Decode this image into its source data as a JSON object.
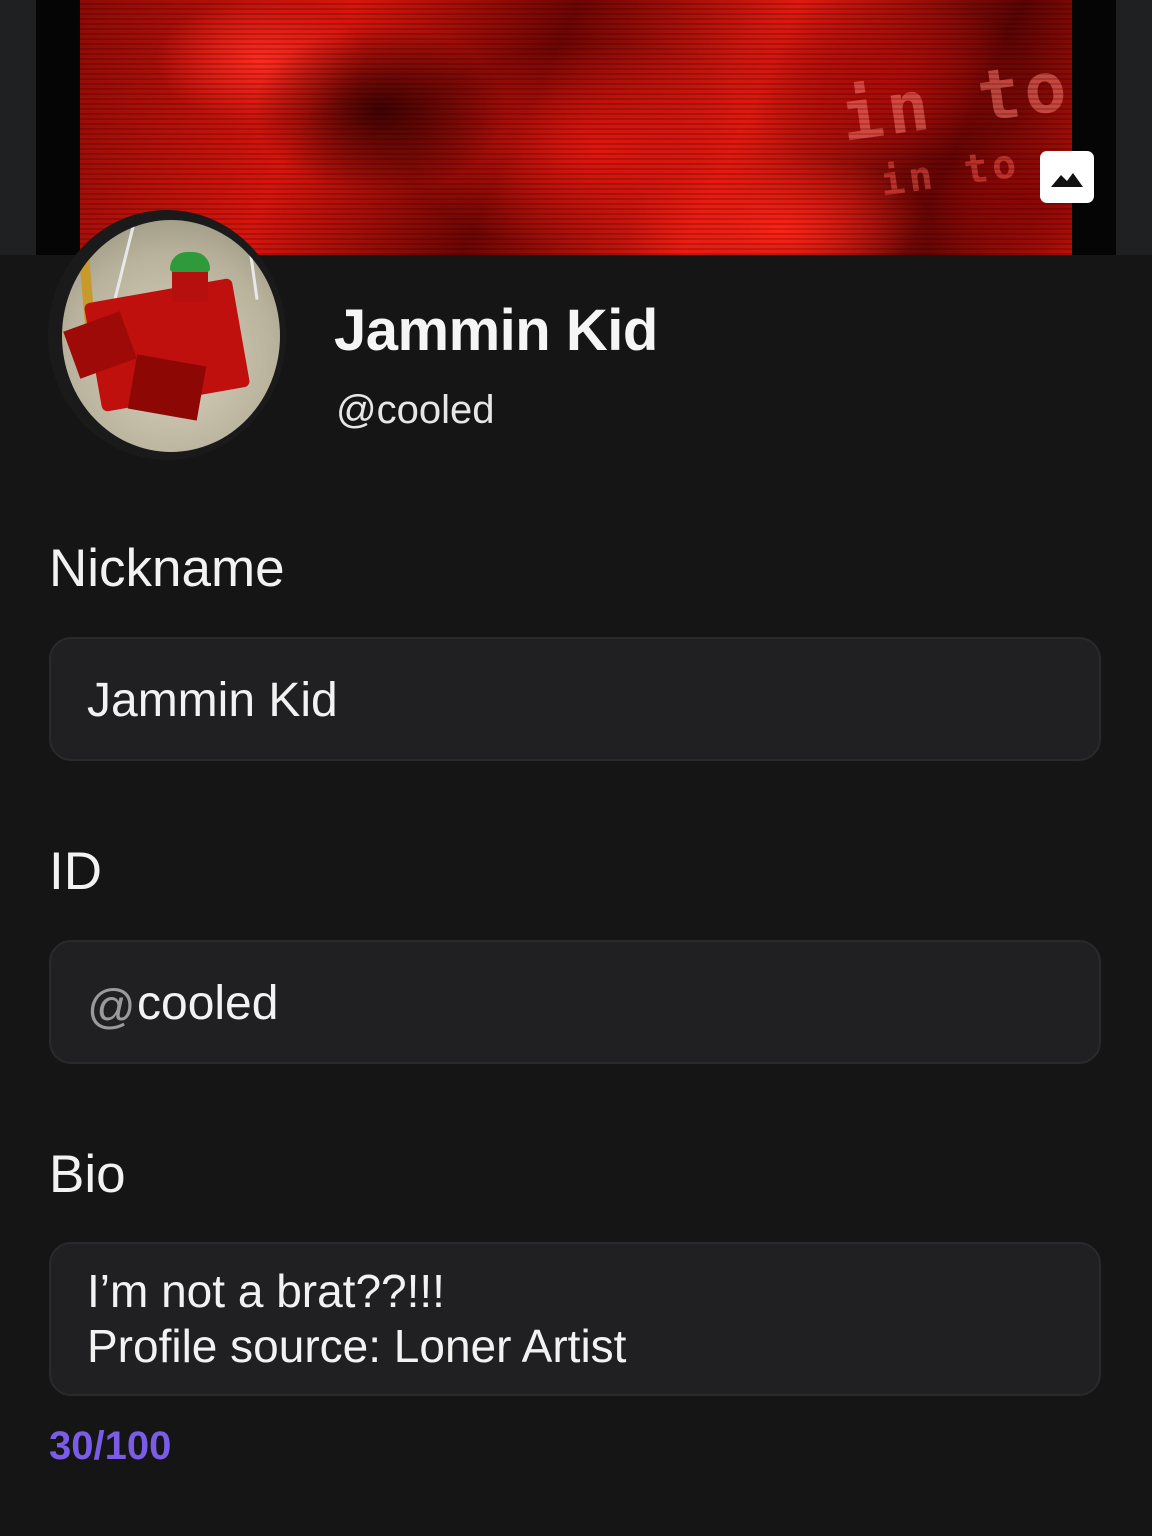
{
  "banner": {
    "overlay_text_1": "in to",
    "overlay_text_2": "in to",
    "edit_icon": "image-icon"
  },
  "profile": {
    "display_name": "Jammin Kid",
    "handle": "@cooled"
  },
  "form": {
    "nickname": {
      "label": "Nickname",
      "value": "Jammin Kid"
    },
    "id": {
      "label": "ID",
      "prefix": "@",
      "value": "cooled"
    },
    "bio": {
      "label": "Bio",
      "line1": "I’m not a brat??!!!",
      "line2": "Profile source: Loner Artist",
      "counter": "30/100"
    }
  },
  "colors": {
    "background": "#151516",
    "field_background": "#202022",
    "accent": "#7b5ce6",
    "banner_red": "#e3160e"
  }
}
